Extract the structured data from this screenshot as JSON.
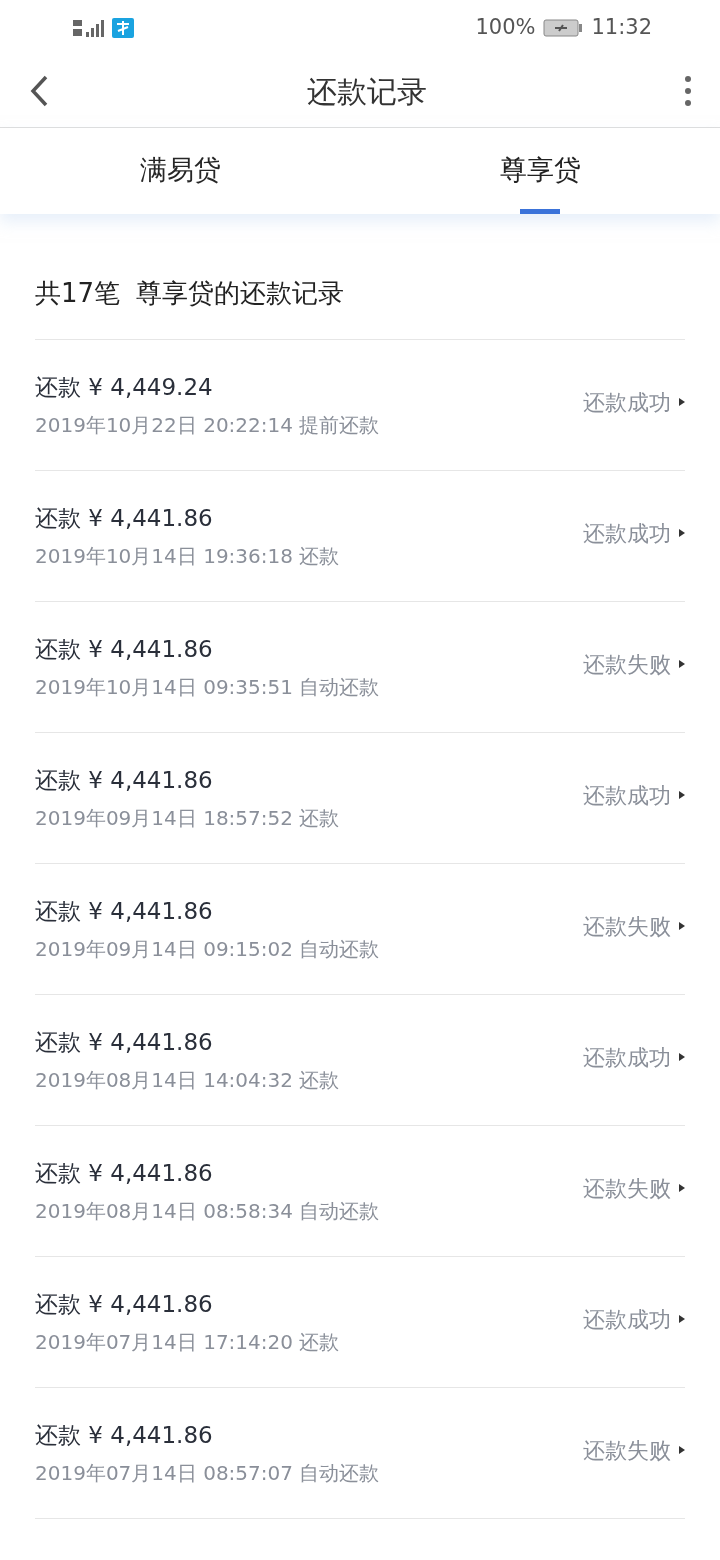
{
  "status_bar": {
    "battery": "100%",
    "time": "11:32"
  },
  "header": {
    "title": "还款记录"
  },
  "tabs": [
    {
      "label": "满易贷",
      "selected": false
    },
    {
      "label": "尊享贷",
      "selected": true
    }
  ],
  "summary": {
    "count": "共17笔",
    "title": "尊享贷的还款记录"
  },
  "records": [
    {
      "amount": "还款 ¥ 4,449.24",
      "time": "2019年10月22日 20:22:14 提前还款",
      "status": "还款成功"
    },
    {
      "amount": "还款 ¥ 4,441.86",
      "time": "2019年10月14日 19:36:18 还款",
      "status": "还款成功"
    },
    {
      "amount": "还款 ¥ 4,441.86",
      "time": "2019年10月14日 09:35:51 自动还款",
      "status": "还款失败"
    },
    {
      "amount": "还款 ¥ 4,441.86",
      "time": "2019年09月14日 18:57:52 还款",
      "status": "还款成功"
    },
    {
      "amount": "还款 ¥ 4,441.86",
      "time": "2019年09月14日 09:15:02 自动还款",
      "status": "还款失败"
    },
    {
      "amount": "还款 ¥ 4,441.86",
      "time": "2019年08月14日 14:04:32 还款",
      "status": "还款成功"
    },
    {
      "amount": "还款 ¥ 4,441.86",
      "time": "2019年08月14日 08:58:34 自动还款",
      "status": "还款失败"
    },
    {
      "amount": "还款 ¥ 4,441.86",
      "time": "2019年07月14日 17:14:20 还款",
      "status": "还款成功"
    },
    {
      "amount": "还款 ¥ 4,441.86",
      "time": "2019年07月14日 08:57:07 自动还款",
      "status": "还款失败"
    }
  ]
}
